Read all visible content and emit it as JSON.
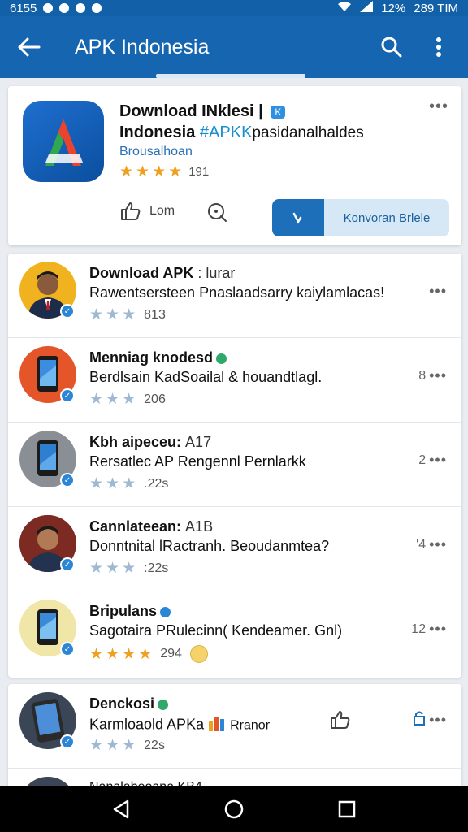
{
  "status": {
    "time_left": "6155",
    "battery": "12%",
    "time_right": "289 TIM"
  },
  "appbar": {
    "title": "APK Indonesia",
    "back_icon": "arrow-left-icon",
    "search_icon": "search-icon",
    "menu_icon": "more-vert-icon"
  },
  "hero": {
    "title_line1": "Download INklesi |",
    "title_badge": "K",
    "title_line2_main": "Indonesia",
    "title_line2_tag": "#APKK",
    "title_line2_tail": "pasidanalhaldes",
    "subtitle": "Brousalhoan",
    "rating_value": "191",
    "stars": 4,
    "like_label": "Lom",
    "download_label": "Konvoran Brlele",
    "accent": "#1565b0"
  },
  "list": [
    {
      "title": "Download APK",
      "title_aux": ": lurar",
      "subtitle": "Rawentsersteen Pnaslaadsarry kaiylamlacas!",
      "stars": 3,
      "count": "813",
      "meta": "",
      "avatar": "person-avatar-1",
      "badge": "none"
    },
    {
      "title": "Menniag knodesd",
      "title_aux": "",
      "subtitle": "Berdlsain KadSoailal & houandtlagl.",
      "stars": 3,
      "count": "206",
      "meta": "8",
      "avatar": "phone-avatar-orange",
      "badge": "green"
    },
    {
      "title": "Kbh aipeceu:",
      "title_aux": "A17",
      "subtitle": "Rersatlec AP Rengennl Pernlarkk",
      "stars": 3,
      "count": ".22s",
      "meta": "2",
      "avatar": "phone-avatar-gray",
      "badge": "none"
    },
    {
      "title": "Cannlateean:",
      "title_aux": "A1B",
      "subtitle": "Donntnital lRactranh. Beoudanmtea?",
      "stars": 3,
      "count": ":22s",
      "meta": "'4",
      "avatar": "person-avatar-2",
      "badge": "none"
    },
    {
      "title": "Bripulans",
      "title_aux": "",
      "subtitle": "Sagotaira PRulecinn( Kendeamer. Gnl)",
      "stars": 4,
      "count": "294",
      "meta": "12",
      "avatar": "phone-avatar-yellow",
      "badge": "blue"
    }
  ],
  "list2": [
    {
      "title": "Denckosi",
      "subtitle": "Karmloaold APKa",
      "subtitle_tail": "Rranor",
      "stars": 3,
      "count": "22s",
      "avatar": "phone-avatar-photo",
      "badge": "green"
    },
    {
      "title": "Nanalabeoana KB4"
    }
  ],
  "colors": {
    "star_filled": "#f0a020",
    "star_muted": "#9fb9d3",
    "link_blue": "#2b6fb5"
  }
}
